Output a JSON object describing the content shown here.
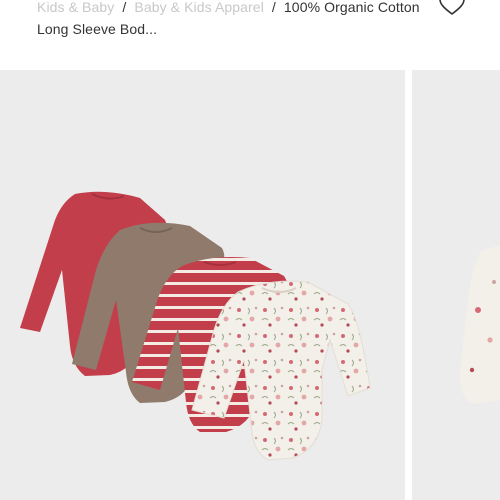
{
  "breadcrumb": {
    "items": [
      "Kids & Baby",
      "Baby & Kids Apparel"
    ],
    "separator": "/",
    "current": "100% Organic Cotton Long Sleeve Bod..."
  },
  "wishlist": {
    "icon": "heart-outline-icon"
  },
  "gallery": {
    "main_image": {
      "description_colors": [
        "#c33e4b",
        "#8f7a6b",
        "#c33e4b",
        "#f3efe9"
      ]
    },
    "next_image": {
      "partial": true
    }
  },
  "colors": {
    "background": "#ececec",
    "red": "#c33e4b",
    "oatmeal": "#8f7a6b",
    "ivory": "#f3efe9"
  }
}
